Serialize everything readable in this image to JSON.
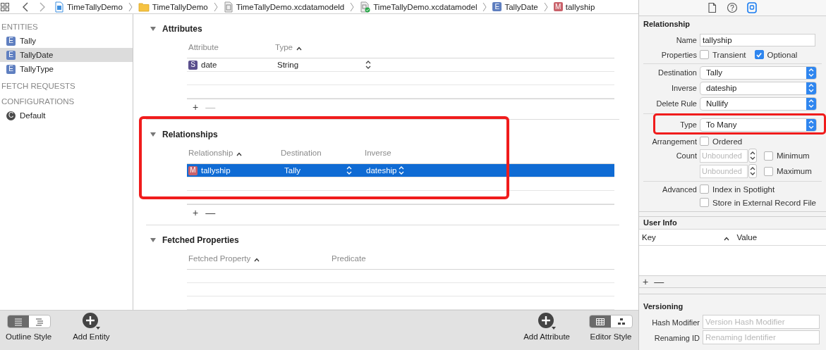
{
  "breadcrumb_bar": {
    "items": [
      {
        "kind": "project",
        "label": "TimeTallyDemo"
      },
      {
        "kind": "folder",
        "label": "TimeTallyDemo"
      },
      {
        "kind": "bundle",
        "label": "TimeTallyDemo.xcdatamodeld"
      },
      {
        "kind": "model",
        "label": "TimeTallyDemo.xcdatamodel"
      },
      {
        "kind": "entity",
        "badge": "E",
        "label": "TallyDate"
      },
      {
        "kind": "relationship",
        "badge": "M",
        "label": "tallyship"
      }
    ]
  },
  "sidebar": {
    "sections": [
      {
        "title": "ENTITIES",
        "items": [
          {
            "kind": "entity",
            "badge": "E",
            "label": "Tally",
            "selected": false
          },
          {
            "kind": "entity",
            "badge": "E",
            "label": "TallyDate",
            "selected": true
          },
          {
            "kind": "entity",
            "badge": "E",
            "label": "TallyType",
            "selected": false
          }
        ]
      },
      {
        "title": "FETCH REQUESTS"
      },
      {
        "title": "CONFIGURATIONS",
        "items": [
          {
            "kind": "configuration",
            "badge": "C",
            "label": "Default",
            "selected": false
          }
        ]
      }
    ]
  },
  "editor": {
    "sections": [
      {
        "kind": "attributes",
        "title": "Attributes",
        "expanded": true,
        "highlighted": false,
        "columns": [
          {
            "label": "Attribute",
            "sorted": false
          },
          {
            "label": "Type",
            "sorted": true
          }
        ],
        "rows": [
          {
            "selected": false,
            "cells": [
              {
                "kind": "attribute",
                "badge": "S",
                "text": "date",
                "popup": false
              },
              {
                "text": "String",
                "popup": true
              }
            ]
          }
        ],
        "add_button": "+",
        "remove_button": {
          "label": "—",
          "disabled": true
        }
      },
      {
        "kind": "relationships",
        "title": "Relationships",
        "expanded": true,
        "highlighted": true,
        "columns": [
          {
            "label": "Relationship",
            "sorted": true
          },
          {
            "label": "Destination",
            "sorted": false
          },
          {
            "label": "Inverse",
            "sorted": false
          }
        ],
        "rows": [
          {
            "selected": true,
            "cells": [
              {
                "kind": "relationship",
                "badge": "M",
                "text": "tallyship",
                "popup": false
              },
              {
                "text": "Tally",
                "popup": true
              },
              {
                "text": "dateship",
                "popup": true
              }
            ]
          }
        ],
        "add_button": "+",
        "remove_button": {
          "label": "—",
          "disabled": false
        }
      },
      {
        "kind": "fetched",
        "title": "Fetched Properties",
        "expanded": true,
        "highlighted": false,
        "columns": [
          {
            "label": "Fetched Property",
            "sorted": true
          },
          {
            "label": "Predicate",
            "sorted": false
          }
        ]
      }
    ]
  },
  "bottom_bar": {
    "left": [
      {
        "kind": "segmented",
        "label": "Outline Style",
        "segments": [
          {
            "kind": "list",
            "selected": true
          },
          {
            "kind": "outline",
            "selected": false
          }
        ]
      },
      {
        "kind": "add",
        "label": "Add Entity"
      }
    ],
    "right": [
      {
        "kind": "add",
        "label": "Add Attribute"
      },
      {
        "kind": "segmented",
        "label": "Editor Style",
        "segments": [
          {
            "kind": "table",
            "selected": true
          },
          {
            "kind": "graph",
            "selected": false
          }
        ]
      }
    ]
  },
  "inspector": {
    "tabs": [
      {
        "kind": "file",
        "selected": false
      },
      {
        "kind": "help",
        "selected": false
      },
      {
        "kind": "attributes",
        "selected": true
      }
    ],
    "sections": [
      {
        "kind": "form",
        "title": "Relationship",
        "groups": [
          {
            "rows": [
              {
                "kind": "text",
                "label": "Name",
                "value": "tallyship"
              },
              {
                "kind": "checks",
                "label": "Properties",
                "checks": [
                  {
                    "label": "Transient",
                    "checked": false
                  },
                  {
                    "label": "Optional",
                    "checked": true
                  }
                ]
              }
            ]
          },
          {
            "rows": [
              {
                "kind": "popup",
                "label": "Destination",
                "value": "Tally",
                "highlighted": false
              },
              {
                "kind": "popup",
                "label": "Inverse",
                "value": "dateship",
                "highlighted": false
              },
              {
                "kind": "popup",
                "label": "Delete Rule",
                "value": "Nullify",
                "highlighted": false
              }
            ]
          },
          {
            "rows": [
              {
                "kind": "popup",
                "label": "Type",
                "value": "To Many",
                "highlighted": true
              },
              {
                "kind": "checks",
                "label": "Arrangement",
                "checks": [
                  {
                    "label": "Ordered",
                    "checked": false
                  }
                ]
              },
              {
                "kind": "stepper",
                "label": "Count",
                "placeholder": "Unbounded",
                "checks": [
                  {
                    "label": "Minimum",
                    "checked": false
                  }
                ]
              },
              {
                "kind": "stepper",
                "placeholder": "Unbounded",
                "checks": [
                  {
                    "label": "Maximum",
                    "checked": false
                  }
                ]
              }
            ]
          },
          {
            "rows": [
              {
                "kind": "checks",
                "label": "Advanced",
                "checks": [
                  {
                    "label": "Index in Spotlight",
                    "checked": false
                  }
                ]
              },
              {
                "kind": "checks",
                "checks": [
                  {
                    "label": "Store in External Record File",
                    "checked": false
                  }
                ]
              }
            ]
          }
        ]
      },
      {
        "kind": "table",
        "title": "User Info",
        "columns": [
          {
            "label": "Key",
            "sorted": true
          },
          {
            "label": "Value",
            "sorted": false
          }
        ],
        "add_button": "+",
        "remove_button": {
          "label": "—",
          "disabled": false
        }
      },
      {
        "kind": "form",
        "title": "Versioning",
        "groups": [
          {
            "rows": [
              {
                "kind": "text",
                "label": "Hash Modifier",
                "placeholder": "Version Hash Modifier"
              },
              {
                "kind": "text",
                "label": "Renaming ID",
                "placeholder": "Renaming Identifier"
              }
            ]
          }
        ]
      }
    ]
  }
}
